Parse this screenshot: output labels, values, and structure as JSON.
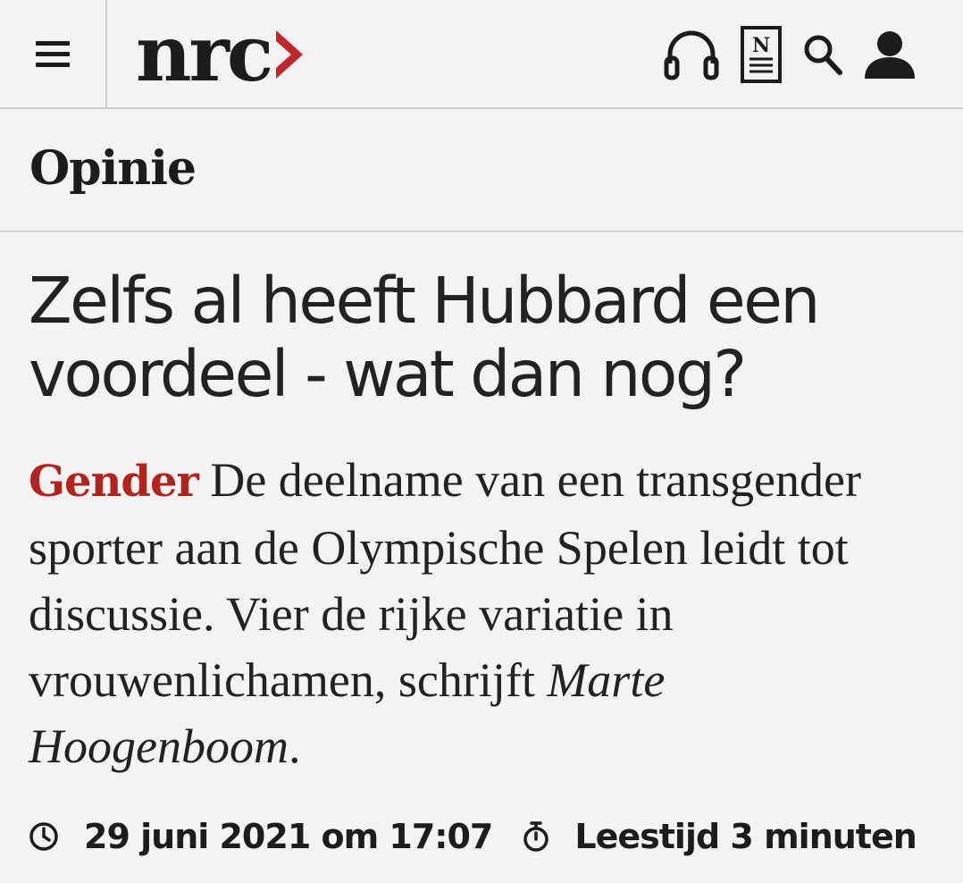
{
  "header": {
    "logo_text": "nrc",
    "logo_chevron": "›",
    "logo_accent_color": "#c0272d",
    "icons": [
      "menu-icon",
      "headphones-icon",
      "newspaper-icon",
      "search-icon",
      "user-icon"
    ],
    "newspaper_icon_letter": "N"
  },
  "section": {
    "label": "Opinie"
  },
  "article": {
    "headline": "Zelfs al heeft Hubbard een voordeel - wat dan nog?",
    "kicker": "Gender",
    "kicker_color": "#b1241e",
    "intro": " De deelname van een transgender sporter aan de Olympische Spelen leidt tot discussie. Vier de rijke variatie in vrouwenlichamen, schrijft ",
    "author": "Marte Hoogenboom",
    "intro_end": ".",
    "date": "29 juni 2021 om 17:07",
    "reading_time": "Leestijd 3 minuten"
  }
}
